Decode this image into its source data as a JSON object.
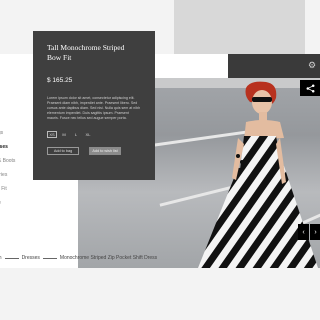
{
  "sidebar": {
    "items": [
      {
        "label": "s"
      },
      {
        "label": "ings"
      },
      {
        "label": "esses",
        "active": true
      },
      {
        "label": "s & Boots"
      },
      {
        "label": "sories"
      },
      {
        "label": "By Fit"
      },
      {
        "label": ""
      },
      {
        "label": "Me"
      }
    ]
  },
  "product": {
    "title": "Tall Monochrome Striped Bow Fit",
    "price": "$ 165.25",
    "description": "Lorem ipsum dolor sit amet, consectetur adipiscing elit. Praesent diam nibh, imperdiet ante. Praesent libero. Sed cursus ante dapibus diam. Sed nisi. Nulla quis sem at nibh elementum imperdiet. Duis sagittis ipsum. Praesent mauris. Fusce nec tellus sed augue semper porta.",
    "sizes": [
      "XS",
      "M",
      "L",
      "XL"
    ],
    "selected_size": "XS",
    "add_to_bag": "Add to bag",
    "add_to_wishlist": "Add to wish list"
  },
  "breadcrumb": {
    "items": [
      "on",
      "Dresses",
      "Monochrome Striped Zip Pocket Shift Dress"
    ]
  },
  "icons": {
    "share": "share-icon",
    "prev": "chevron-left-icon",
    "next": "chevron-right-icon"
  },
  "colors": {
    "panel": "#3f3f3f",
    "header": "#3a3a3a",
    "accent_dark": "#000000",
    "hair": "#c0392b"
  }
}
